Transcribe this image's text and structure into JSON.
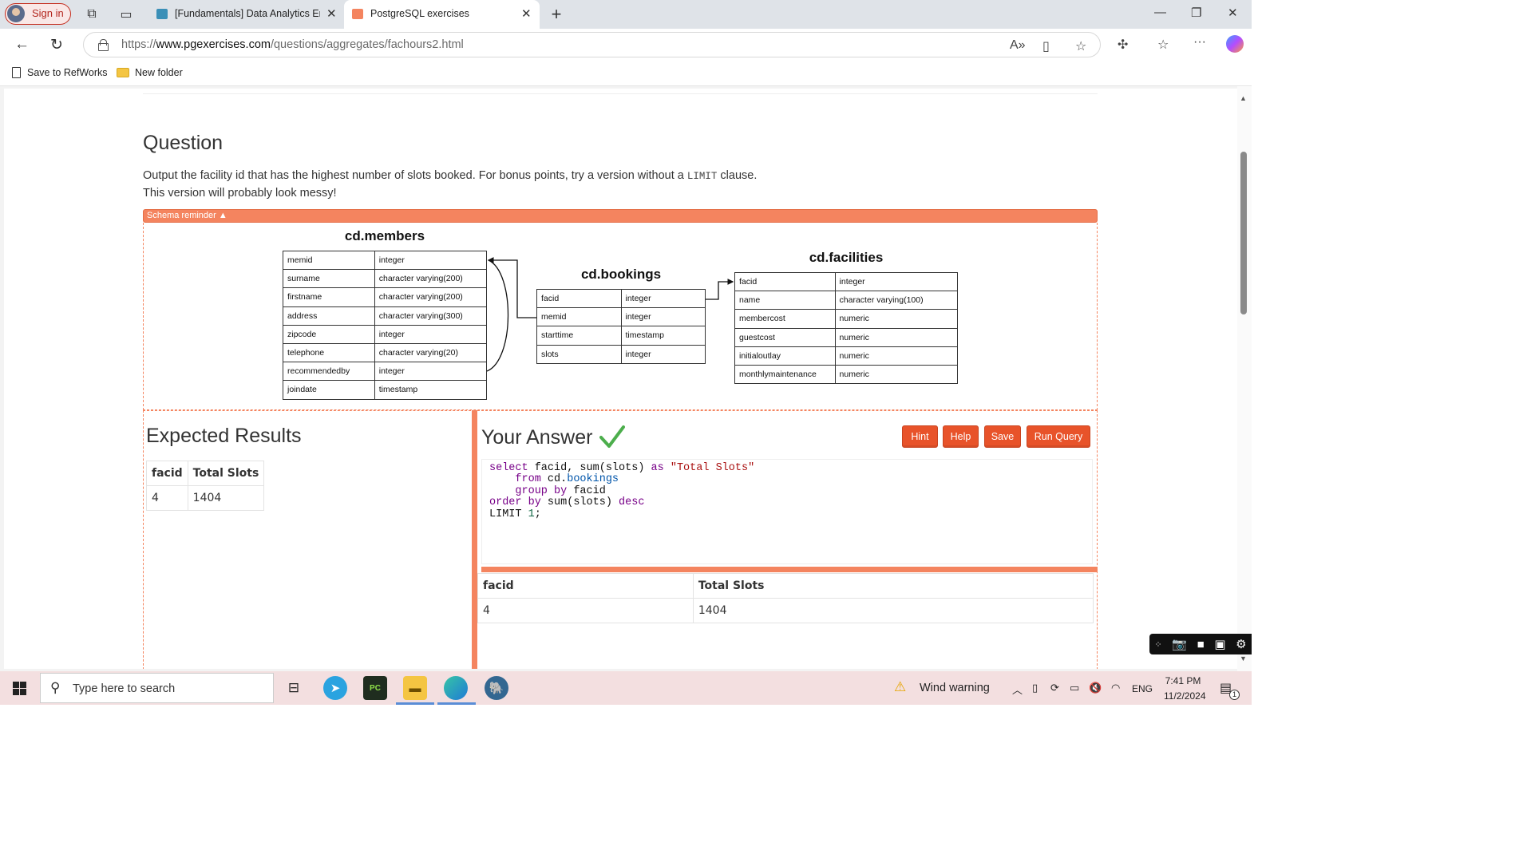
{
  "browser": {
    "signin_label": "Sign in",
    "tabs": [
      {
        "title": "[Fundamentals] Data Analytics En",
        "favicon_color": "#3a8fb7"
      },
      {
        "title": "PostgreSQL exercises",
        "favicon_color": "#f4845f"
      }
    ],
    "url_prefix": "https://",
    "url_host": "www.pgexercises.com",
    "url_path": "/questions/aggregates/fachours2.html",
    "favorites": [
      "Save to RefWorks",
      "New folder"
    ]
  },
  "question": {
    "heading": "Question",
    "line1_before": "Output the facility id that has the highest number of slots booked. For bonus points, try a version without a ",
    "line1_code": "LIMIT",
    "line1_after": " clause.",
    "line2": "This version will probably look messy!"
  },
  "schema": {
    "toggle_label": "Schema reminder ▲",
    "members": {
      "title": "cd.members",
      "rows": [
        [
          "memid",
          "integer"
        ],
        [
          "surname",
          "character varying(200)"
        ],
        [
          "firstname",
          "character varying(200)"
        ],
        [
          "address",
          "character varying(300)"
        ],
        [
          "zipcode",
          "integer"
        ],
        [
          "telephone",
          "character varying(20)"
        ],
        [
          "recommendedby",
          "integer"
        ],
        [
          "joindate",
          "timestamp"
        ]
      ]
    },
    "bookings": {
      "title": "cd.bookings",
      "rows": [
        [
          "facid",
          "integer"
        ],
        [
          "memid",
          "integer"
        ],
        [
          "starttime",
          "timestamp"
        ],
        [
          "slots",
          "integer"
        ]
      ]
    },
    "facilities": {
      "title": "cd.facilities",
      "rows": [
        [
          "facid",
          "integer"
        ],
        [
          "name",
          "character varying(100)"
        ],
        [
          "membercost",
          "numeric"
        ],
        [
          "guestcost",
          "numeric"
        ],
        [
          "initialoutlay",
          "numeric"
        ],
        [
          "monthlymaintenance",
          "numeric"
        ]
      ]
    }
  },
  "expected": {
    "heading": "Expected Results",
    "columns": [
      "facid",
      "Total Slots"
    ],
    "rows": [
      [
        "4",
        "1404"
      ]
    ]
  },
  "answer": {
    "heading": "Your Answer",
    "buttons": [
      "Hint",
      "Help",
      "Save",
      "Run Query"
    ],
    "code_lines": [
      "select facid, sum(slots) as \"Total Slots\"",
      "    from cd.bookings",
      "    group by facid",
      "order by sum(slots) desc",
      "LIMIT 1;"
    ],
    "result_columns": [
      "facid",
      "Total Slots"
    ],
    "result_rows": [
      [
        "4",
        "1404"
      ]
    ]
  },
  "taskbar": {
    "search_placeholder": "Type here to search",
    "weather": "Wind warning",
    "language": "ENG",
    "time": "7:41 PM",
    "date": "11/2/2024",
    "notification_count": "1"
  },
  "colors": {
    "accent": "#f4845f",
    "button": "#e8532a"
  }
}
